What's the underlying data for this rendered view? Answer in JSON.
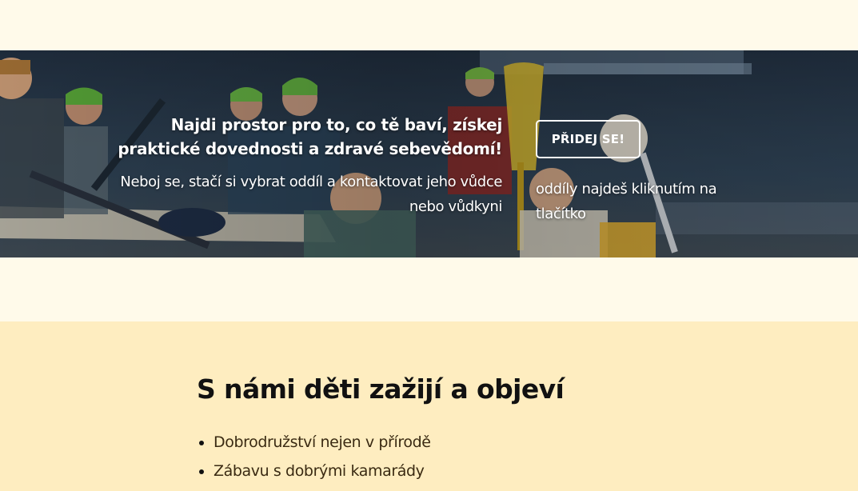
{
  "hero": {
    "headline_line1": "Najdi prostor pro to, co tě baví, získej",
    "headline_line2": "praktické dovednosti a zdravé sebevědomí!",
    "subtext_line1": "Neboj se, stačí si vybrat oddíl a kontaktovat jeho vůdce",
    "subtext_line2": "nebo vůdkyni",
    "join_button_label": "PŘIDEJ SE!",
    "hint_line1": "oddíly najdeš kliknutím na",
    "hint_line2": "tlačítko"
  },
  "features": {
    "title": "S námi děti zažijí a objeví",
    "items": [
      "Dobrodružství nejen v přírodě",
      "Zábavu s dobrými kamarády"
    ]
  },
  "colors": {
    "page_background": "#fffaea",
    "features_background": "#feedc0",
    "hero_text": "#ffffff",
    "title_text": "#111111"
  }
}
